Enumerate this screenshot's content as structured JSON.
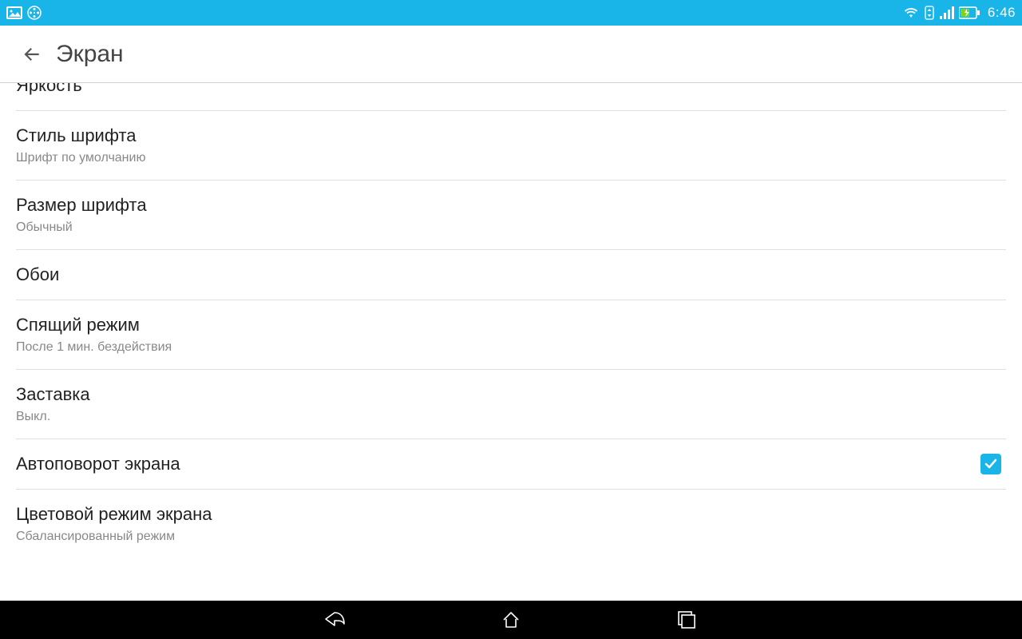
{
  "status": {
    "clock": "6:46"
  },
  "header": {
    "title": "Экран"
  },
  "items": [
    {
      "title": "Яркость",
      "sub": ""
    },
    {
      "title": "Стиль шрифта",
      "sub": "Шрифт по умолчанию"
    },
    {
      "title": "Размер шрифта",
      "sub": "Обычный"
    },
    {
      "title": "Обои",
      "sub": ""
    },
    {
      "title": "Спящий режим",
      "sub": "После 1 мин. бездействия"
    },
    {
      "title": "Заставка",
      "sub": "Выкл."
    },
    {
      "title": "Автоповорот экрана",
      "sub": "",
      "checkbox": true,
      "checked": true
    },
    {
      "title": "Цветовой режим экрана",
      "sub": "Сбалансированный режим"
    }
  ],
  "colors": {
    "accent": "#19b5e8"
  }
}
